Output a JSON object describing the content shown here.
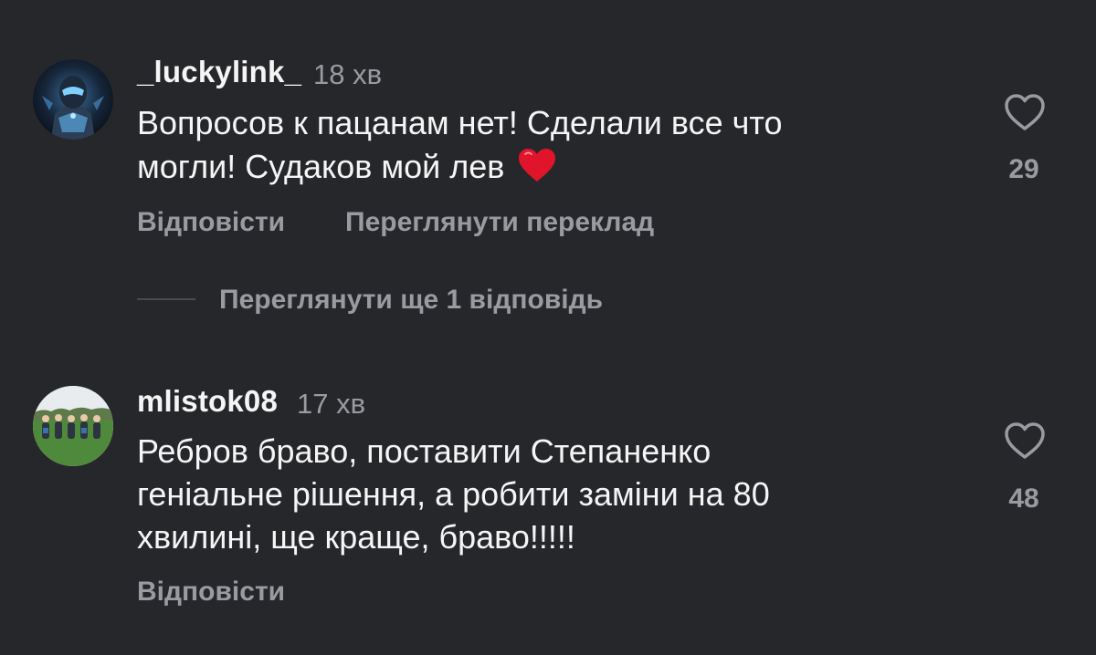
{
  "comments": [
    {
      "username": "_luckylink_",
      "time": "18 хв",
      "text_line1": "Вопросов к пацанам нет! Сделали все что",
      "text_line2": "могли! Судаков мой лев",
      "emoji": "red-heart",
      "likes": "29",
      "reply_label": "Відповісти",
      "translate_label": "Переглянути переклад",
      "view_replies_label": "Переглянути ще 1 відповідь",
      "avatar_icon": "armored-character-avatar"
    },
    {
      "username": "mlistok08",
      "time": "17 хв",
      "text_line1": "Ребров браво, поставити Степаненко",
      "text_line2": "геніальне рішення, а робити заміни на 80",
      "text_line3": "хвилині, ще краще, браво!!!!!",
      "likes": "48",
      "reply_label": "Відповісти",
      "avatar_icon": "team-photo-avatar"
    }
  ],
  "colors": {
    "background": "#26272b",
    "primary_text": "#f5f5f5",
    "secondary_text": "#9a9ba0",
    "heart_emoji": "#e0142b"
  },
  "icons": {
    "like": "heart-outline-icon"
  }
}
